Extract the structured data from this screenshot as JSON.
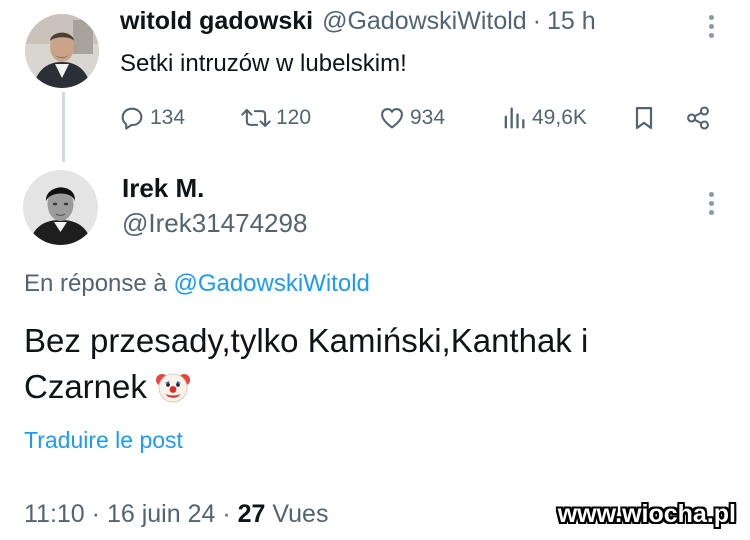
{
  "parent_tweet": {
    "author_name": "witold gadowski",
    "handle": "@GadowskiWitold",
    "separator": "·",
    "time": "15 h",
    "text": "Setki intruzów w lubelskim!",
    "stats": {
      "replies": "134",
      "reposts": "120",
      "likes": "934",
      "views": "49,6K"
    }
  },
  "reply_tweet": {
    "author_name": "Irek M.",
    "handle": "@Irek31474298",
    "reply_prefix": "En réponse à",
    "reply_to_handle": "@GadowskiWitold",
    "body_line1": "Bez przesady,tylko Kamiński,Kanthak i",
    "body_line2": "Czarnek",
    "body_emoji": "clown-face-emoji",
    "translate_label": "Traduire le post",
    "time": "11:10",
    "separator": "·",
    "date": "16 juin 24",
    "views_count": "27",
    "views_label": "Vues"
  },
  "watermark": "www.wiocha.pl",
  "colors": {
    "text_primary": "#0f1419",
    "text_secondary": "#536471",
    "link": "#1d9bf0",
    "thread_line": "#cfd9de"
  },
  "icons": [
    "reply-icon",
    "repost-icon",
    "like-icon",
    "views-icon",
    "bookmark-icon",
    "share-icon",
    "more-icon"
  ]
}
